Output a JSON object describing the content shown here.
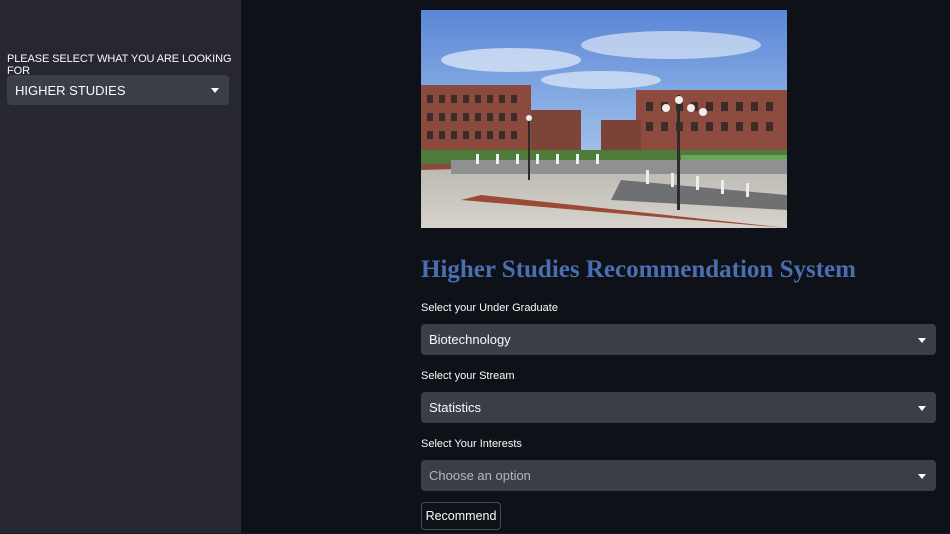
{
  "sidebar": {
    "looking_for_label": "PLEASE SELECT WHAT YOU ARE LOOKING FOR",
    "looking_for_value": "HIGHER STUDIES"
  },
  "main": {
    "title": "Higher Studies Recommendation System",
    "title_color": "#4a6fb0",
    "under_graduate": {
      "label": "Select your Under Graduate",
      "value": "Biotechnology"
    },
    "stream": {
      "label": "Select your Stream",
      "value": "Statistics"
    },
    "interests": {
      "label": "Select Your Interests",
      "placeholder": "Choose an option"
    },
    "recommend_button": "Recommend"
  },
  "colors": {
    "background": "#0e1117",
    "sidebar": "#262730",
    "select": "#3b3d47"
  },
  "icons": [
    "chevron-down-icon",
    "campus-photo"
  ]
}
